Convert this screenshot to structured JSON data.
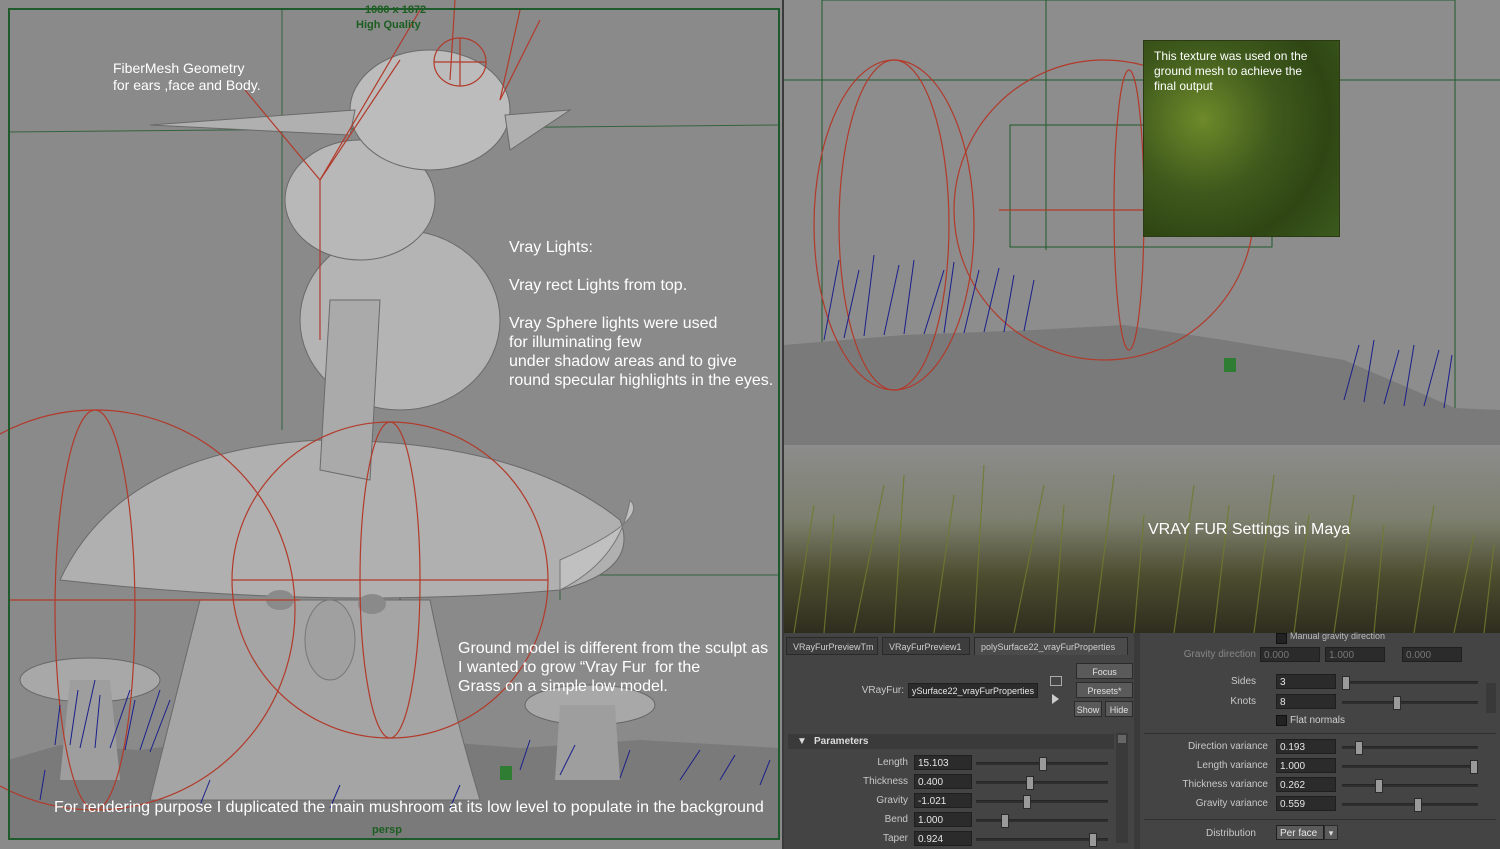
{
  "left_viewport": {
    "resolution_label": "1080 x 1872",
    "quality_label": "High Quality",
    "camera_label": "persp",
    "notes": {
      "fibermesh": "FiberMesh Geometry\nfor ears ,face and Body.",
      "vray_lights": "Vray Lights:\n\nVray rect Lights from top.\n\nVray Sphere lights were used\nfor illuminating few\nunder shadow areas and to give\nround specular highlights in the eyes.",
      "ground_model": "Ground model is different from the sculpt as\nI wanted to grow “Vray Fur  for the\nGrass on a simple low model.",
      "rendering": "For rendering purpose I duplicated the main mushroom at its low level to populate in the background"
    }
  },
  "right_viewport": {
    "texture_note": "This texture was used on the\nground mesh to achieve the\nfinal output"
  },
  "grass_render": {
    "caption": "VRAY FUR Settings in Maya"
  },
  "attribute_editor": {
    "tabs": [
      "VRayFurPreviewTm",
      "VRayFurPreview1",
      "polySurface22_vrayFurProperties"
    ],
    "active_tab": 2,
    "node_label": "VRayFur:",
    "node_value": "ySurface22_vrayFurProperties",
    "buttons": {
      "focus": "Focus",
      "presets": "Presets*",
      "show": "Show",
      "hide": "Hide"
    },
    "section": "Parameters",
    "params": [
      {
        "label": "Length",
        "value": "15.103",
        "level": 0.5
      },
      {
        "label": "Thickness",
        "value": "0.400",
        "level": 0.4
      },
      {
        "label": "Gravity",
        "value": "-1.021",
        "level": 0.37
      },
      {
        "label": "Bend",
        "value": "1.000",
        "level": 0.2
      },
      {
        "label": "Taper",
        "value": "0.924",
        "level": 0.9
      }
    ],
    "right": {
      "manual_gravity": "Manual gravity direction",
      "gravity_direction_label": "Gravity direction",
      "gravity_direction": [
        "0.000",
        "1.000",
        "0.000"
      ],
      "sides_label": "Sides",
      "sides": "3",
      "sides_level": 0.0,
      "knots_label": "Knots",
      "knots": "8",
      "knots_level": 0.4,
      "flat_normals": "Flat normals",
      "variances": [
        {
          "label": "Direction variance",
          "value": "0.193",
          "level": 0.1
        },
        {
          "label": "Length variance",
          "value": "1.000",
          "level": 1.0
        },
        {
          "label": "Thickness variance",
          "value": "0.262",
          "level": 0.26
        },
        {
          "label": "Gravity variance",
          "value": "0.559",
          "level": 0.56
        }
      ],
      "distribution_label": "Distribution",
      "distribution": "Per face"
    }
  },
  "colors": {
    "viewport_bg": "#8a8a8a",
    "camera_frame": "#1f5a2c",
    "light_gizmo": "#b23a2a",
    "fur_preview": "#1a1f8a",
    "panel_bg": "#444444"
  }
}
